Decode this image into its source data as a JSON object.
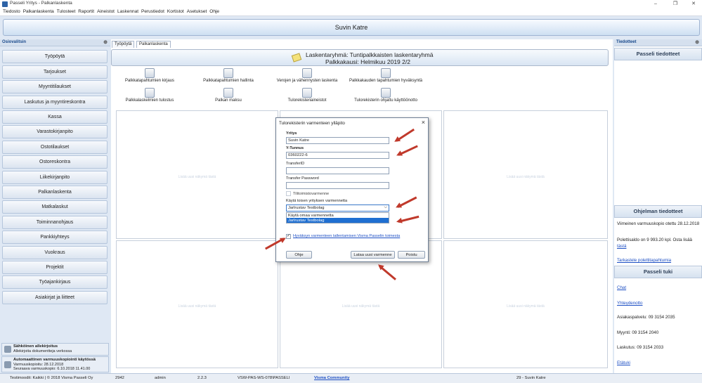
{
  "window": {
    "title": "Passeli Yritys - Palkanlaskenta"
  },
  "menu": [
    "Tiedosto",
    "Palkanlaskenta",
    "Tulosteet",
    "Raportit",
    "Aineistot",
    "Laskennat",
    "Perustiedot",
    "Kortistot",
    "Asetukset",
    "Ohje"
  ],
  "user": {
    "name": "Suvin Katre"
  },
  "left_panel": {
    "title": "Osiovalitsin",
    "items": [
      "Työpöytä",
      "Tarjoukset",
      "Myyntitilaukset",
      "Laskutus ja myyntireskontra",
      "Kassa",
      "Varastokirjanpito",
      "Ostotilaukset",
      "Ostoreskontra",
      "Liikekirjanpito",
      "Palkanlaskenta",
      "Matkalaskut",
      "Toiminnanohjaus",
      "Pankkiyhteys",
      "Vuokraus",
      "Projektit",
      "Työajankirjaus",
      "Asiakirjat ja liitteet"
    ],
    "bottom": [
      {
        "title": "Sähköinen allekirjoitus",
        "lines": [
          "Allekirjoita dokumentteja verkossa"
        ]
      },
      {
        "title": "Automaattinen varmuuskopiointi käytössä",
        "lines": [
          "Varmuuskopioitu: 28.12.2018",
          "Seuraava varmuuskopio: 6.10.2018 11.41.00"
        ]
      }
    ]
  },
  "tabs": [
    "Työpöytä",
    "Palkanlaskenta"
  ],
  "center_header": {
    "line1": "Laskentaryhmä: Tuntipalkkaisten laskentaryhmä",
    "line2": "Palkkakausi: Helmikuu  2019 2/2"
  },
  "tools_row1": [
    "Palkkatapahtumien kirjaus",
    "Palkkatapahtumien hallinta",
    "Verojen ja vähennysten laskenta",
    "Palkkakauden tapahtumien hyväksyntä"
  ],
  "tools_row2": [
    "Palkkalaskelmien tulostus",
    "Palkan maksu",
    "Tulorekisteriaineistot",
    "Tulorekisterin ohjattu käyttöönotto"
  ],
  "ghost_text": "Lisää uusi näkymä tästä",
  "dialog": {
    "title": "Tulorekisterin varmenteen ylläpito",
    "yritys_label": "Yritys",
    "yritys_value": "Suvin Katre",
    "ytunnus_label": "Y-Tunnus",
    "ytunnus_value": "0360222-6",
    "transferid_label": "TransferID",
    "transferpw_label": "Transfer Password",
    "tilitoimisto_label": "Tilitoimistovarmenne",
    "kayta_label": "Käytä toisen yrityksen varmennetta",
    "select_value": "Jarlrustav Testbolag",
    "options": [
      "Käytä omaa varmennetta",
      "Jarlrustav Testbolag"
    ],
    "accept_label": "Hyväksyn varmenteen tallentamisen Visma Passelin toimesta",
    "btn_help": "Ohje",
    "btn_load": "Lataa uusi varmenne",
    "btn_remove": "Poistu"
  },
  "right_panel": {
    "title": "Tiedotteet",
    "head1": "Passeli tiedotteet",
    "head2": "Ohjelman tiedotteet",
    "backup_text": "Viimeinen varmuuskopio otettu 28.12.2018",
    "balance_text": "Polettisaldo on 9 993.20 kpl. Osta lisää",
    "balance_link": "tästä",
    "events_link": "Tarkastele polettitapahtumia",
    "head3": "Passeli tuki",
    "chat": "Chat",
    "contact": "Yhteydenotto",
    "service": "Asiakaspalvelu: 09 3154 2035",
    "sales": "Myynti: 09 3154 2040",
    "billing": "Laskutus: 09 3154 2033",
    "remote": "Etätuki"
  },
  "status": {
    "left": "Testimoodit: Kaikki | © 2018 Visma Passeli Oy",
    "num": "2942",
    "user": "admin",
    "version": "2.2.3",
    "machine": "VSW-PAS-WS-078\\PASSELI",
    "community": "Visma Community",
    "right": "29 - Suvin Katre"
  },
  "colors": {
    "accent": "#1a4a8c",
    "arrow": "#c0392b",
    "selection": "#1f6fd1"
  }
}
